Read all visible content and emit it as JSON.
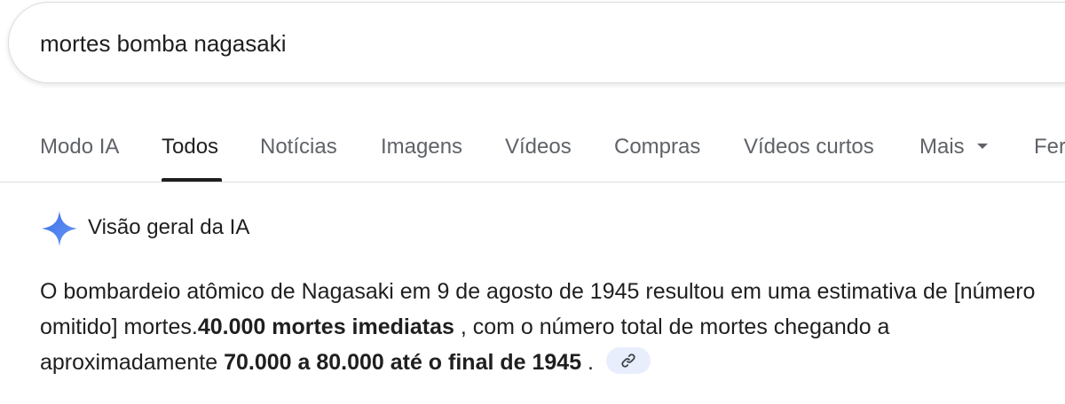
{
  "search": {
    "query": "mortes bomba nagasaki"
  },
  "tabs": [
    {
      "label": "Modo IA",
      "active": false
    },
    {
      "label": "Todos",
      "active": true
    },
    {
      "label": "Notícias",
      "active": false
    },
    {
      "label": "Imagens",
      "active": false
    },
    {
      "label": "Vídeos",
      "active": false
    },
    {
      "label": "Compras",
      "active": false
    },
    {
      "label": "Vídeos curtos",
      "active": false
    },
    {
      "label": "Mais",
      "active": false
    },
    {
      "label": "Fer",
      "active": false
    }
  ],
  "ai_overview": {
    "title": "Visão geral da IA",
    "icon": "sparkle-icon",
    "icon_color": "#4c7cf0",
    "text_1": "O bombardeio atômico de Nagasaki em 9 de agosto de 1945 resultou em uma estimativa de [número omitido] mortes.",
    "bold_1": "40.000 mortes imediatas",
    "text_2": " , com o número total de mortes chegando a aproximadamente ",
    "bold_2": "70.000 a 80.000 até o final de 1945",
    "text_3": " .",
    "link_icon": "link-icon"
  },
  "colors": {
    "text": "#1f1f1f",
    "muted": "#5f6368",
    "border": "#dadce0",
    "chip": "#e8eefc"
  }
}
